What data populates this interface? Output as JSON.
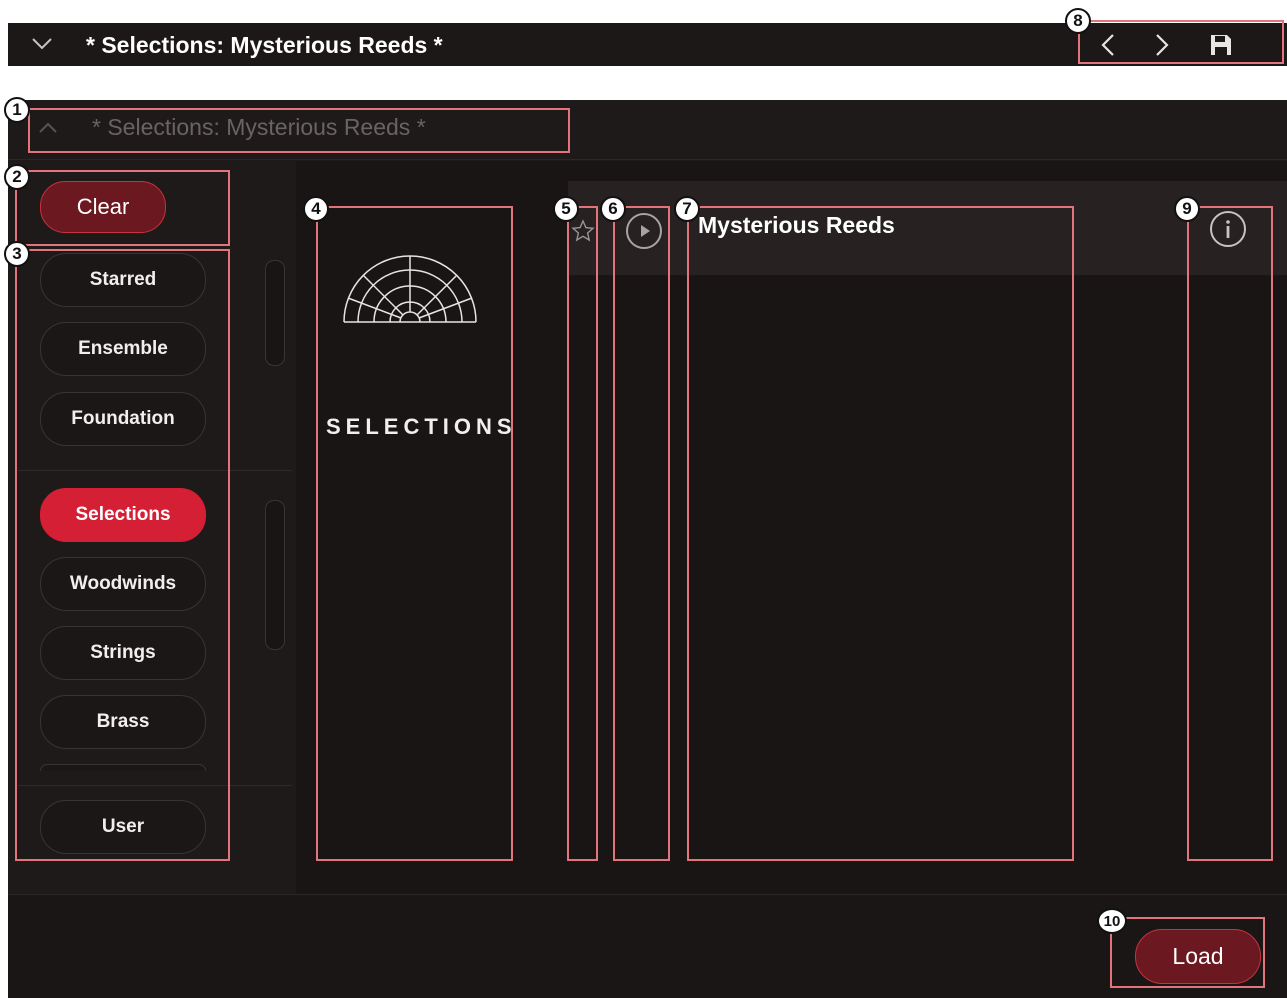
{
  "window": {
    "title": "* Selections: Mysterious Reeds *"
  },
  "subheader": {
    "title": "* Selections: Mysterious Reeds *"
  },
  "clear_label": "Clear",
  "load_label": "Load",
  "filters": {
    "group1": [
      {
        "label": "Starred"
      },
      {
        "label": "Ensemble"
      },
      {
        "label": "Foundation"
      }
    ],
    "group2": [
      {
        "label": "Selections"
      },
      {
        "label": "Woodwinds"
      },
      {
        "label": "Strings"
      },
      {
        "label": "Brass"
      }
    ],
    "user": "User",
    "active": "Selections"
  },
  "library": {
    "name": "SELECTIONS"
  },
  "preset": {
    "name": "Mysterious Reeds"
  },
  "annotations": [
    "1",
    "2",
    "3",
    "4",
    "5",
    "6",
    "7",
    "8",
    "9",
    "10"
  ],
  "colors": {
    "accent": "#d41f35",
    "annotation": "#e2747c",
    "background": "#1f1a1a"
  }
}
